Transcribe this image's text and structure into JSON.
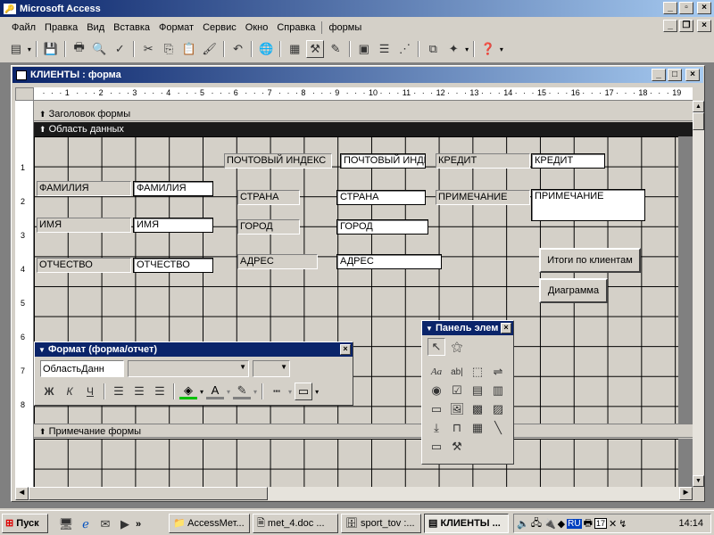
{
  "app": {
    "title": "Microsoft Access"
  },
  "menu": [
    "Файл",
    "Правка",
    "Вид",
    "Вставка",
    "Формат",
    "Сервис",
    "Окно",
    "Справка",
    "формы"
  ],
  "toolbar": {
    "icons": [
      "form-view-icon",
      "save-icon",
      "print-icon",
      "print-preview-icon",
      "spelling-icon",
      "cut-icon",
      "copy-icon",
      "paste-icon",
      "format-painter-icon",
      "undo-icon",
      "insert-hyperlink-icon",
      "field-list-icon",
      "toolbox-icon",
      "autoformat-icon",
      "code-icon",
      "properties-icon",
      "build-icon",
      "database-window-icon",
      "new-object-icon",
      "help-icon"
    ]
  },
  "form_window": {
    "title": "КЛИЕНТЫ : форма",
    "ruler_numbers": [
      "1",
      "2",
      "3",
      "4",
      "5",
      "6",
      "7",
      "8",
      "9",
      "10",
      "11",
      "12",
      "13",
      "14",
      "15",
      "16",
      "17",
      "18",
      "19"
    ],
    "vertical_ruler": [
      "1",
      "2",
      "3",
      "4",
      "5",
      "6",
      "7",
      "8"
    ]
  },
  "bands": {
    "header": "Заголовок формы",
    "detail": "Область данных",
    "footer": "Примечание формы"
  },
  "controls": {
    "postal_label": "ПОЧТОВЫЙ ИНДЕКС",
    "postal_field": "ПОЧТОВЫЙ ИНДЕКС",
    "credit_label": "КРЕДИТ",
    "credit_field": "КРЕДИТ",
    "surname_label": "ФАМИЛИЯ",
    "surname_field": "ФАМИЛИЯ",
    "country_label": "СТРАНА",
    "country_field": "СТРАНА",
    "note_label": "ПРИМЕЧАНИЕ",
    "note_field": "ПРИМЕЧАНИЕ",
    "name_label": "ИМЯ",
    "name_field": "ИМЯ",
    "city_label": "ГОРОД",
    "city_field": "ГОРОД",
    "patronymic_label": "ОТЧЕСТВО",
    "patronymic_field": "ОТЧЕСТВО",
    "address_label": "АДРЕС",
    "address_field": "АДРЕС",
    "totals_button": "Итоги по клиентам",
    "chart_button": "Диаграмма"
  },
  "format_palette": {
    "title": "Формат (форма/отчет)",
    "object_select": "ОбластьДанн",
    "bold": "Ж",
    "italic": "К",
    "underline": "Ч"
  },
  "toolbox": {
    "title": "Панель элем",
    "text_tool": "Aa",
    "field_tool": "ab|"
  },
  "taskbar": {
    "start": "Пуск",
    "tasks": [
      "AccessМет...",
      "met_4.doc ...",
      "sport_tov :...",
      "КЛИЕНТЫ ..."
    ],
    "lang": "RU",
    "clock": "14:14",
    "tray_number": "17"
  }
}
